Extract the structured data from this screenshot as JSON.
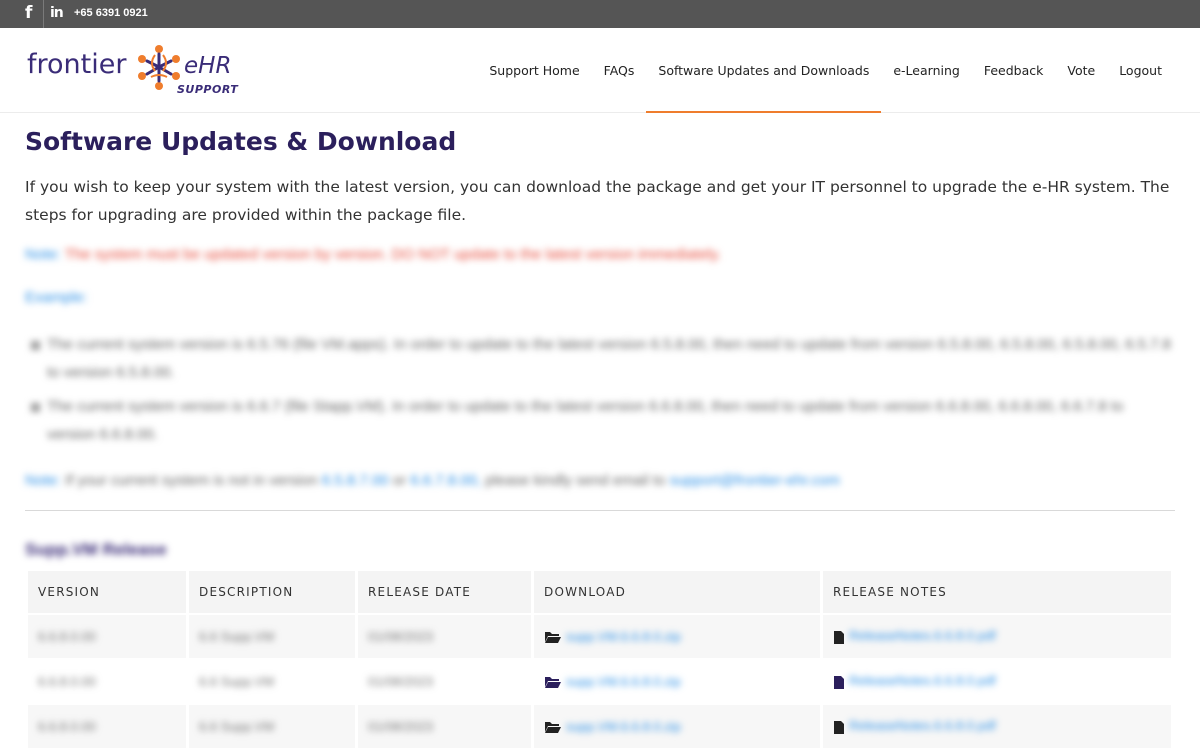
{
  "topbar": {
    "facebook_icon": "f",
    "linkedin_icon": "in",
    "phone": "+65 6391 0921"
  },
  "logo": {
    "word1": "frontier",
    "word2": "eHR",
    "sub": "SUPPORT",
    "colors": {
      "text": "#3a2c78",
      "accent": "#ef7d2d"
    }
  },
  "nav": {
    "items": [
      "Support Home",
      "FAQs",
      "Software Updates and Downloads",
      "e-Learning",
      "Feedback",
      "Vote",
      "Logout"
    ],
    "active_index": 2
  },
  "page": {
    "title": "Software Updates & Download",
    "intro": "If you wish to keep your system with the latest version, you can download the package and get your IT personnel to upgrade the e-HR system. The steps for upgrading are provided within the package file.",
    "note1_label": "Note:",
    "note1_text": "The system must be updated version by version. DO NOT update to the latest version immediately.",
    "example_label": "Example:",
    "examples": [
      "The current system version is 6.5.76 (file VM.apps). In order to update to the latest version 6.5.8.00, then need to update from version 6.5.8.00, 6.5.8.00, 6.5.8.00, 6.5.7.8 to version 6.5.8.00.",
      "The current system version is 6.6.7 (file Stapp.VM). In order to update to the latest version 6.6.8.00, then need to update from version 6.6.8.00, 6.6.8.00, 6.6.7.8 to version 6.6.8.00."
    ],
    "note2_label": "Note:",
    "note2_text_a": "If your current system is not in version",
    "note2_v1": "6.5.8.7.00",
    "note2_and": "or",
    "note2_v2": "6.6.7.8.00,",
    "note2_text_b": "please kindly send email to",
    "note2_email": "support@frontier-ehr.com",
    "section_title": "Supp.VM Release",
    "colors": {
      "title": "#2b1f5c",
      "link": "#2a8fe6",
      "warning": "#e74c3c"
    }
  },
  "table": {
    "headers": [
      "VERSION",
      "DESCRIPTION",
      "RELEASE DATE",
      "DOWNLOAD",
      "RELEASE NOTES"
    ],
    "rows": [
      {
        "version": "6.6.8.0.00",
        "description": "6.6 Supp.VM",
        "date": "01/08/2023",
        "download": "supp.VM.6.6.8.0.zip",
        "notes": "ReleaseNotes.6.6.8.0.pdf"
      },
      {
        "version": "6.6.8.0.00",
        "description": "6.6 Supp.VM",
        "date": "01/08/2023",
        "download": "supp.VM.6.6.8.0.zip",
        "notes": "ReleaseNotes.6.6.8.0.pdf"
      },
      {
        "version": "6.6.8.0.00",
        "description": "6.6 Supp.VM",
        "date": "01/08/2023",
        "download": "supp.VM.6.6.8.0.zip",
        "notes": "ReleaseNotes.6.6.8.0.pdf"
      }
    ]
  }
}
